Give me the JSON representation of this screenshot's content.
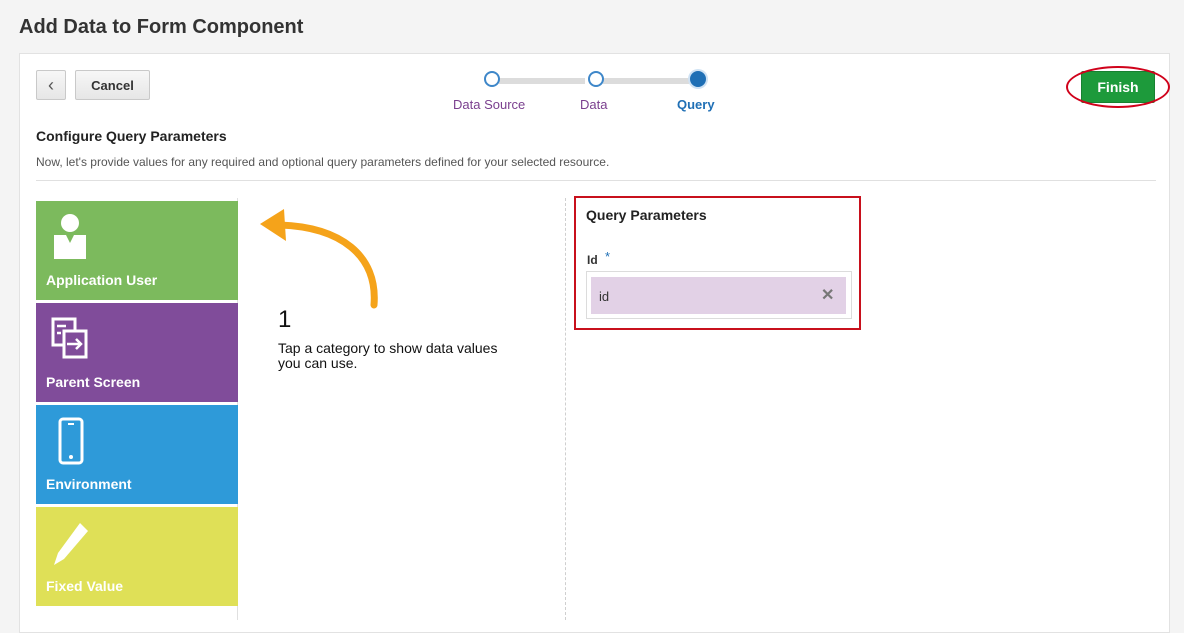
{
  "page_title": "Add Data to Form Component",
  "toolbar": {
    "back_glyph": "‹",
    "cancel_label": "Cancel",
    "finish_label": "Finish"
  },
  "train": {
    "steps": [
      {
        "label": "Data Source",
        "state": "visited"
      },
      {
        "label": "Data",
        "state": "visited"
      },
      {
        "label": "Query",
        "state": "current"
      }
    ]
  },
  "section": {
    "heading": "Configure Query Parameters",
    "description": "Now, let's provide values for any required and optional query parameters defined for your selected resource."
  },
  "categories": [
    {
      "label": "Application User",
      "icon": "user-icon",
      "color": "#7cba5d"
    },
    {
      "label": "Parent Screen",
      "icon": "screen-transfer-icon",
      "color": "#804c9a"
    },
    {
      "label": "Environment",
      "icon": "phone-icon",
      "color": "#2e9ad9"
    },
    {
      "label": "Fixed Value",
      "icon": "pencil-icon",
      "color": "#dfe057"
    }
  ],
  "hint": {
    "step": "1",
    "text": "Tap a category to show data values you can use.",
    "arrow_color": "#f5a31a"
  },
  "query_parameters": {
    "title": "Query Parameters",
    "params": [
      {
        "label": "Id",
        "required_marker": "*",
        "value": "id"
      }
    ]
  },
  "colors": {
    "finish": "#1d9a3b",
    "highlight": "#d0021b",
    "accent": "#1f6fb5",
    "field_fill": "#e2d1e6"
  }
}
